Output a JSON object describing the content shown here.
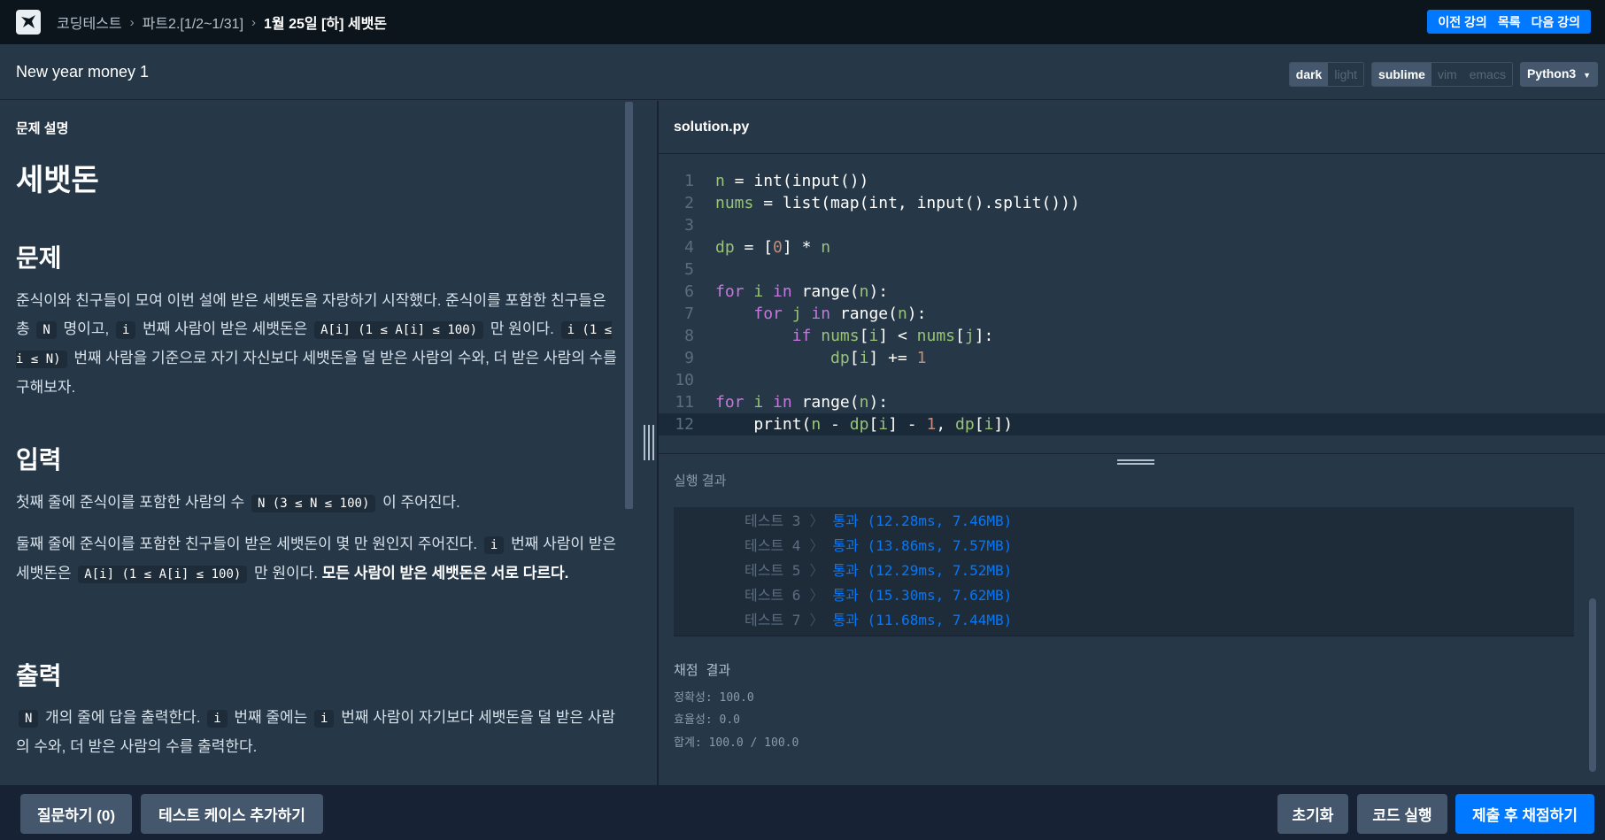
{
  "nav": {
    "breadcrumbs": [
      "코딩테스트",
      "파트2.[1/2~1/31]",
      "1월 25일 [하] 세뱃돈"
    ],
    "prev_label": "이전 강의",
    "list_label": "목록",
    "next_label": "다음 강의"
  },
  "lesson": {
    "title": "New year money 1"
  },
  "toolbar": {
    "themes": [
      "dark",
      "light"
    ],
    "active_theme": "dark",
    "keymaps": [
      "sublime",
      "vim",
      "emacs"
    ],
    "active_keymap": "sublime",
    "language": "Python3"
  },
  "problem": {
    "section_label": "문제 설명",
    "title": "세뱃돈",
    "h_problem": "문제",
    "p1_a": "준식이와 친구들이 모여 이번 설에 받은 세뱃돈을 자랑하기 시작했다. 준식이를 포함한 친구들은 총",
    "p1_code1": "N",
    "p1_b": "명이고,",
    "p1_code2": "i",
    "p1_c": "번째 사람이 받은 세뱃돈은",
    "p1_code3": "A[i] (1 ≤ A[i] ≤ 100)",
    "p1_d": "만 원이다.",
    "p1_code4": "i (1 ≤ i ≤ N)",
    "p1_e": "번째 사람을 기준으로 자기 자신보다 세뱃돈을 덜 받은 사람의 수와, 더 받은 사람의 수를 구해보자.",
    "h_input": "입력",
    "in1_a": "첫째 줄에 준식이를 포함한 사람의 수",
    "in1_code": "N (3 ≤ N ≤ 100)",
    "in1_b": "이 주어진다.",
    "in2_a": "둘째 줄에 준식이를 포함한 친구들이 받은 세뱃돈이 몇 만 원인지 주어진다.",
    "in2_code1": "i",
    "in2_b": "번째 사람이 받은 세뱃돈은",
    "in2_code2": "A[i] (1 ≤ A[i] ≤ 100)",
    "in2_c": "만 원이다.",
    "in2_bold": "모든 사람이 받은 세뱃돈은 서로 다르다.",
    "h_output": "출력",
    "out_code1": "N",
    "out_a": "개의 줄에 답을 출력한다.",
    "out_code2": "i",
    "out_b": "번째 줄에는",
    "out_code3": "i",
    "out_c": "번째 사람이 자기보다 세뱃돈을 덜 받은 사람의 수와, 더 받은 사람의 수를 출력한다."
  },
  "editor": {
    "filename": "solution.py",
    "line_numbers": [
      "1",
      "2",
      "3",
      "4",
      "5",
      "6",
      "7",
      "8",
      "9",
      "10",
      "11",
      "12"
    ]
  },
  "results": {
    "header": "실행 결과",
    "tests": [
      {
        "name": "테스트 3",
        "result": "통과 (12.28ms, 7.46MB)"
      },
      {
        "name": "테스트 4",
        "result": "통과 (13.86ms, 7.57MB)"
      },
      {
        "name": "테스트 5",
        "result": "통과 (12.29ms, 7.52MB)"
      },
      {
        "name": "테스트 6",
        "result": "통과 (15.30ms, 7.62MB)"
      },
      {
        "name": "테스트 7",
        "result": "통과 (11.68ms, 7.44MB)"
      }
    ],
    "score_title": "채점 결과",
    "accuracy": "정확성: 100.0",
    "efficiency": "효율성: 0.0",
    "total": "합계: 100.0 / 100.0"
  },
  "actions": {
    "ask_label": "질문하기 (0)",
    "add_test_label": "테스트 케이스 추가하기",
    "reset_label": "초기화",
    "run_label": "코드 실행",
    "submit_label": "제출 후 채점하기"
  }
}
